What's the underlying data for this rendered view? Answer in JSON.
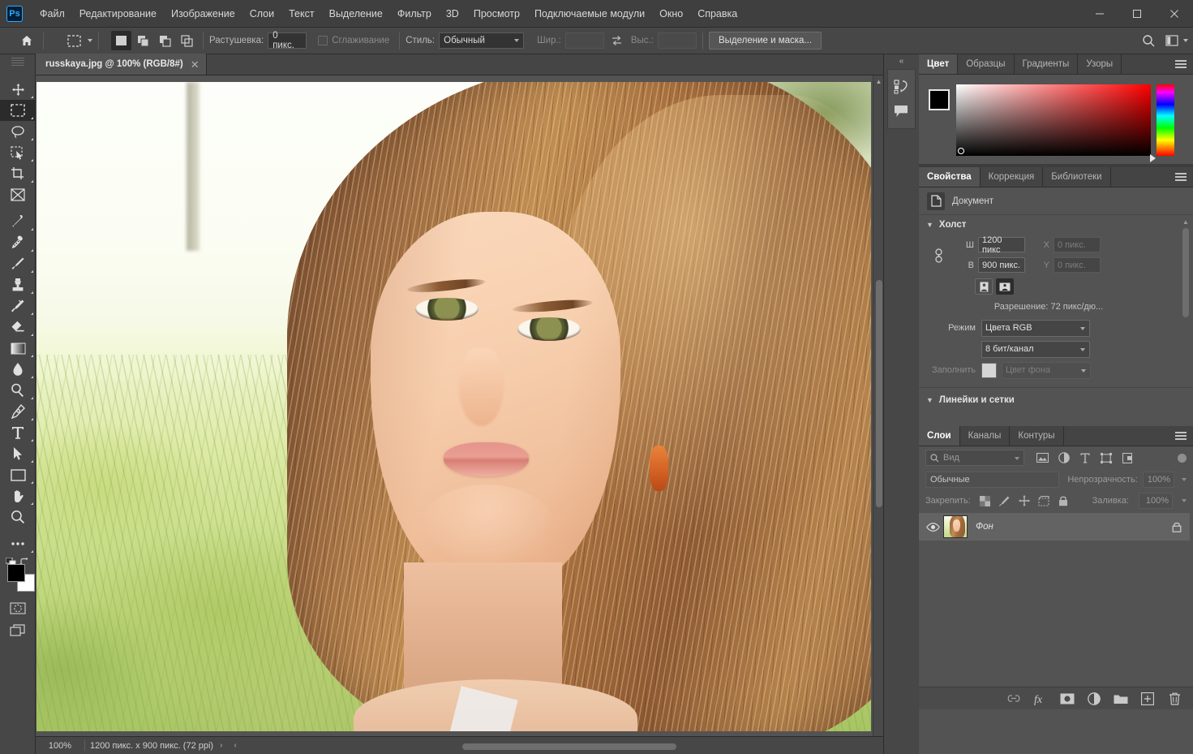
{
  "app": {
    "title": "Adobe Photoshop",
    "logo_text": "Ps"
  },
  "menubar": {
    "items": [
      {
        "label": "Файл",
        "name": "menu-file"
      },
      {
        "label": "Редактирование",
        "name": "menu-edit"
      },
      {
        "label": "Изображение",
        "name": "menu-image"
      },
      {
        "label": "Слои",
        "name": "menu-layers"
      },
      {
        "label": "Текст",
        "name": "menu-text"
      },
      {
        "label": "Выделение",
        "name": "menu-select"
      },
      {
        "label": "Фильтр",
        "name": "menu-filter"
      },
      {
        "label": "3D",
        "name": "menu-3d"
      },
      {
        "label": "Просмотр",
        "name": "menu-view"
      },
      {
        "label": "Подключаемые модули",
        "name": "menu-plugins"
      },
      {
        "label": "Окно",
        "name": "menu-window"
      },
      {
        "label": "Справка",
        "name": "menu-help"
      }
    ]
  },
  "window_controls": {
    "minimize": "—",
    "maximize": "▢",
    "close": "✕"
  },
  "options_bar": {
    "feather_label": "Растушевка:",
    "feather_value": "0 пикс.",
    "antialias_label": "Сглаживание",
    "style_label": "Стиль:",
    "style_value": "Обычный",
    "width_label": "Шир.:",
    "width_value": "",
    "height_label": "Выс.:",
    "height_value": "",
    "select_mask_label": "Выделение и маска..."
  },
  "document_tab": {
    "title": "russkaya.jpg @ 100% (RGB/8#)",
    "close": "✕"
  },
  "toolbar": {
    "tools": [
      {
        "name": "move-tool",
        "label": "Перемещение",
        "active": false
      },
      {
        "name": "rectangular-marquee-tool",
        "label": "Прямоугольная область",
        "active": true
      },
      {
        "name": "lasso-tool",
        "label": "Лассо",
        "active": false
      },
      {
        "name": "quick-selection-tool",
        "label": "Быстрое выделение",
        "active": false
      },
      {
        "name": "crop-tool",
        "label": "Рамка",
        "active": false
      },
      {
        "name": "frame-tool",
        "label": "Кадр",
        "active": false
      },
      {
        "name": "eyedropper-tool",
        "label": "Пипетка",
        "active": false
      },
      {
        "name": "spot-healing-brush-tool",
        "label": "Восстанавливающая кисть",
        "active": false
      },
      {
        "name": "brush-tool",
        "label": "Кисть",
        "active": false
      },
      {
        "name": "clone-stamp-tool",
        "label": "Штамп",
        "active": false
      },
      {
        "name": "history-brush-tool",
        "label": "Архивная кисть",
        "active": false
      },
      {
        "name": "eraser-tool",
        "label": "Ластик",
        "active": false
      },
      {
        "name": "gradient-tool",
        "label": "Градиент",
        "active": false
      },
      {
        "name": "blur-tool",
        "label": "Размытие",
        "active": false
      },
      {
        "name": "dodge-tool",
        "label": "Осветлитель",
        "active": false
      },
      {
        "name": "pen-tool",
        "label": "Перо",
        "active": false
      },
      {
        "name": "type-tool",
        "label": "Текст",
        "active": false
      },
      {
        "name": "path-selection-tool",
        "label": "Выделение контура",
        "active": false
      },
      {
        "name": "rectangle-tool",
        "label": "Прямоугольник",
        "active": false
      },
      {
        "name": "hand-tool",
        "label": "Рука",
        "active": false
      },
      {
        "name": "zoom-tool",
        "label": "Масштаб",
        "active": false
      },
      {
        "name": "edit-toolbar-tool",
        "label": "Редактировать панель инструментов",
        "active": false
      }
    ],
    "foreground_color": "#000000",
    "background_color": "#ffffff"
  },
  "status_bar": {
    "zoom": "100%",
    "doc_info": "1200 пикс. x 900 пикс. (72 ppi)"
  },
  "color_panel": {
    "tabs": [
      {
        "label": "Цвет",
        "active": true
      },
      {
        "label": "Образцы",
        "active": false
      },
      {
        "label": "Градиенты",
        "active": false
      },
      {
        "label": "Узоры",
        "active": false
      }
    ]
  },
  "properties_panel": {
    "tabs": [
      {
        "label": "Свойства",
        "active": true
      },
      {
        "label": "Коррекция",
        "active": false
      },
      {
        "label": "Библиотеки",
        "active": false
      }
    ],
    "header_label": "Документ",
    "canvas_section": "Холст",
    "width_label": "Ш",
    "width_value": "1200 пикс",
    "height_label": "В",
    "height_value": "900 пикс.",
    "x_label": "X",
    "x_value": "0 пикс.",
    "y_label": "Y",
    "y_value": "0 пикс.",
    "resolution_text": "Разрешение: 72 пикс/дю...",
    "mode_label": "Режим",
    "mode_value": "Цвета RGB",
    "depth_value": "8 бит/канал",
    "fill_label": "Заполнить",
    "fill_value": "Цвет фона",
    "rulers_section": "Линейки и сетки"
  },
  "layers_panel": {
    "tabs": [
      {
        "label": "Слои",
        "active": true
      },
      {
        "label": "Каналы",
        "active": false
      },
      {
        "label": "Контуры",
        "active": false
      }
    ],
    "filter_placeholder": "Вид",
    "blend_mode": "Обычные",
    "opacity_label": "Непрозрачность:",
    "opacity_value": "100%",
    "lock_label": "Закрепить:",
    "fill_label": "Заливка:",
    "fill_value": "100%",
    "layers": [
      {
        "name": "Фон",
        "visible": true,
        "locked": true
      }
    ],
    "footer_icons": [
      {
        "name": "link-layers-icon",
        "glyph": "⊷"
      },
      {
        "name": "layer-style-fx-icon",
        "glyph": "fx"
      },
      {
        "name": "add-layer-mask-icon",
        "glyph": "◉"
      },
      {
        "name": "new-adjustment-layer-icon",
        "glyph": "◑"
      },
      {
        "name": "new-group-icon",
        "glyph": "▭"
      },
      {
        "name": "new-layer-icon",
        "glyph": "+"
      },
      {
        "name": "delete-layer-icon",
        "glyph": "🗑"
      }
    ]
  },
  "icon_dock": {
    "collapse": "«",
    "icons": [
      {
        "name": "history-icon"
      },
      {
        "name": "comments-icon"
      }
    ]
  }
}
